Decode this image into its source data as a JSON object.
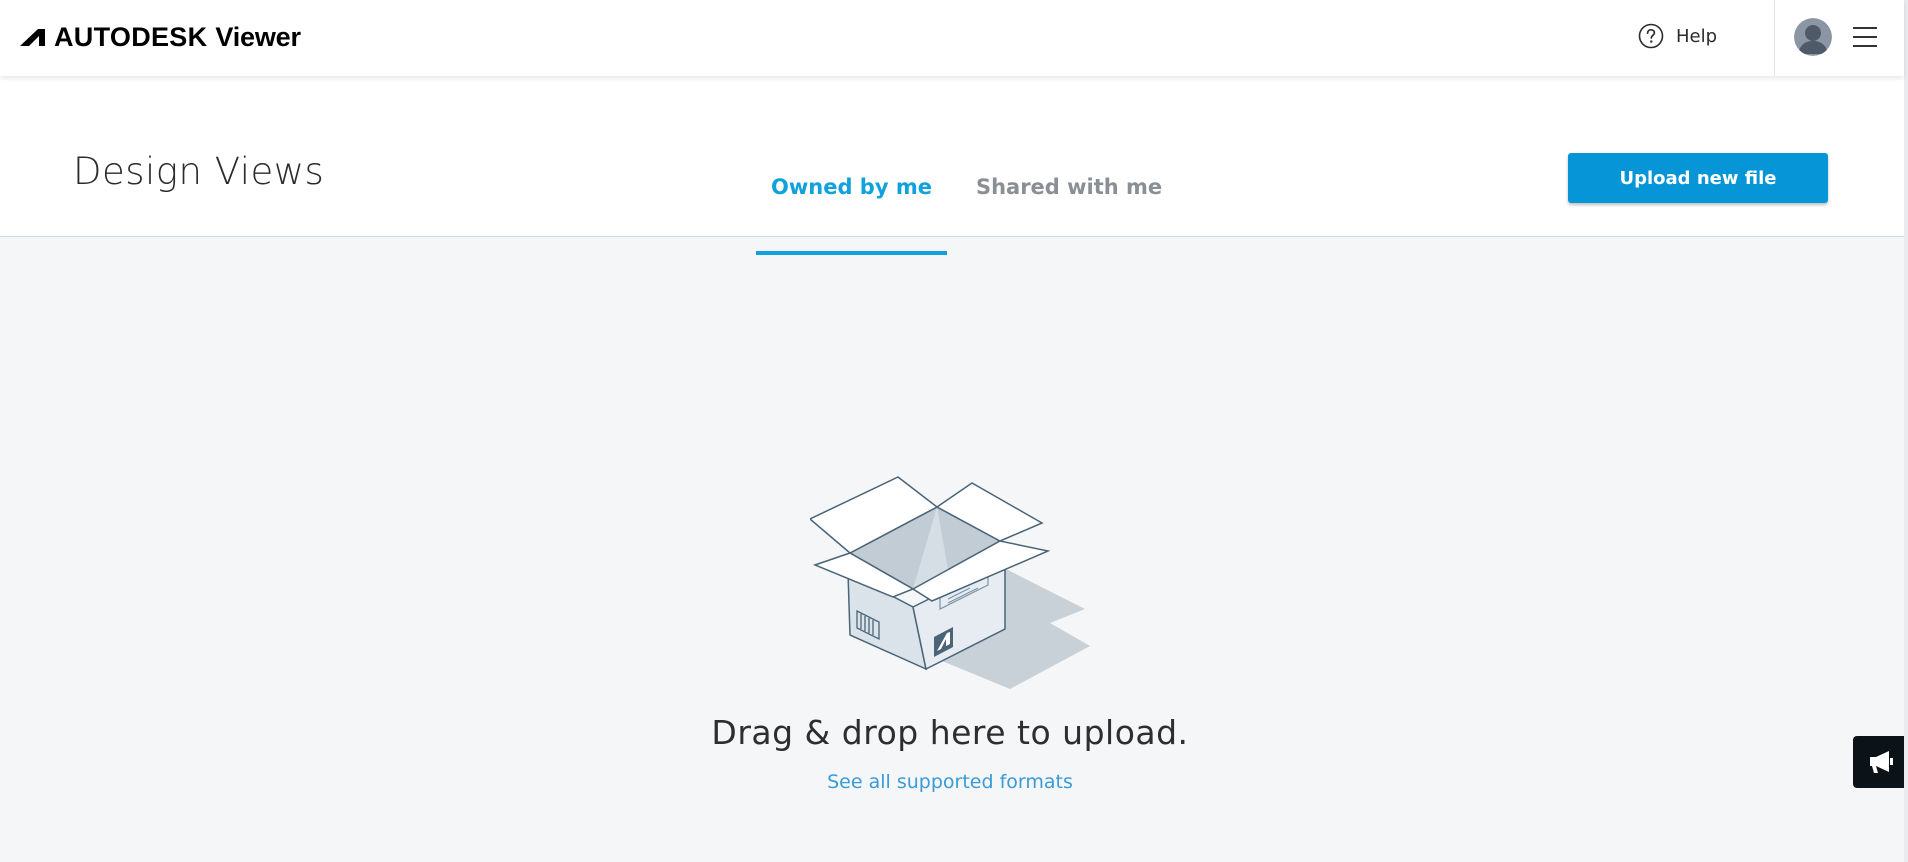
{
  "header": {
    "brand_name": "AUTODESK",
    "product_name": "Viewer",
    "help_label": "Help",
    "icons": {
      "logo": "autodesk-logo-mark",
      "help": "help-circle-icon",
      "avatar": "user-avatar",
      "menu": "hamburger-menu-icon"
    }
  },
  "subheader": {
    "title": "Design Views",
    "tabs": [
      {
        "label": "Owned by me",
        "active": true
      },
      {
        "label": "Shared with me",
        "active": false
      }
    ],
    "upload_button_label": "Upload new file"
  },
  "dropzone": {
    "message": "Drag & drop here to upload.",
    "formats_link": "See all supported formats",
    "illustration": "open-box-illustration"
  },
  "feedback": {
    "icon": "megaphone-icon"
  },
  "colors": {
    "accent": "#0fa2dc",
    "button": "#0696d7",
    "link": "#3a9bd6",
    "background": "#f4f6f8"
  }
}
